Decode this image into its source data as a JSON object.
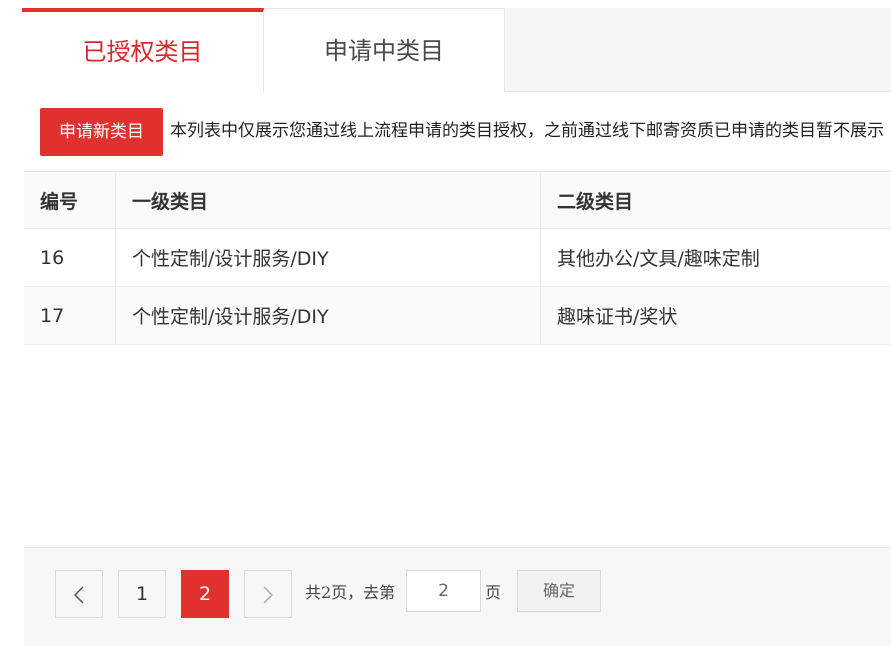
{
  "tabs": [
    {
      "label": "已授权类目",
      "active": true
    },
    {
      "label": "申请中类目",
      "active": false
    }
  ],
  "toolbar": {
    "apply_button": "申请新类目",
    "notice": "本列表中仅展示您通过线上流程申请的类目授权，之前通过线下邮寄资质已申请的类目暂不展示"
  },
  "table": {
    "headers": [
      "编号",
      "一级类目",
      "二级类目"
    ],
    "rows": [
      {
        "id": "16",
        "level1": "个性定制/设计服务/DIY",
        "level2": "其他办公/文具/趣味定制"
      },
      {
        "id": "17",
        "level1": "个性定制/设计服务/DIY",
        "level2": "趣味证书/奖状"
      }
    ]
  },
  "pagination": {
    "pages": [
      "1",
      "2"
    ],
    "current": "2",
    "total_text": "共2页，去第",
    "goto_value": "2",
    "page_suffix": "页",
    "confirm_label": "确定",
    "prev_icon": "chevron-left-icon",
    "next_icon": "chevron-right-icon"
  },
  "colors": {
    "accent": "#e0312f",
    "active_tab_text": "#d9282c"
  }
}
